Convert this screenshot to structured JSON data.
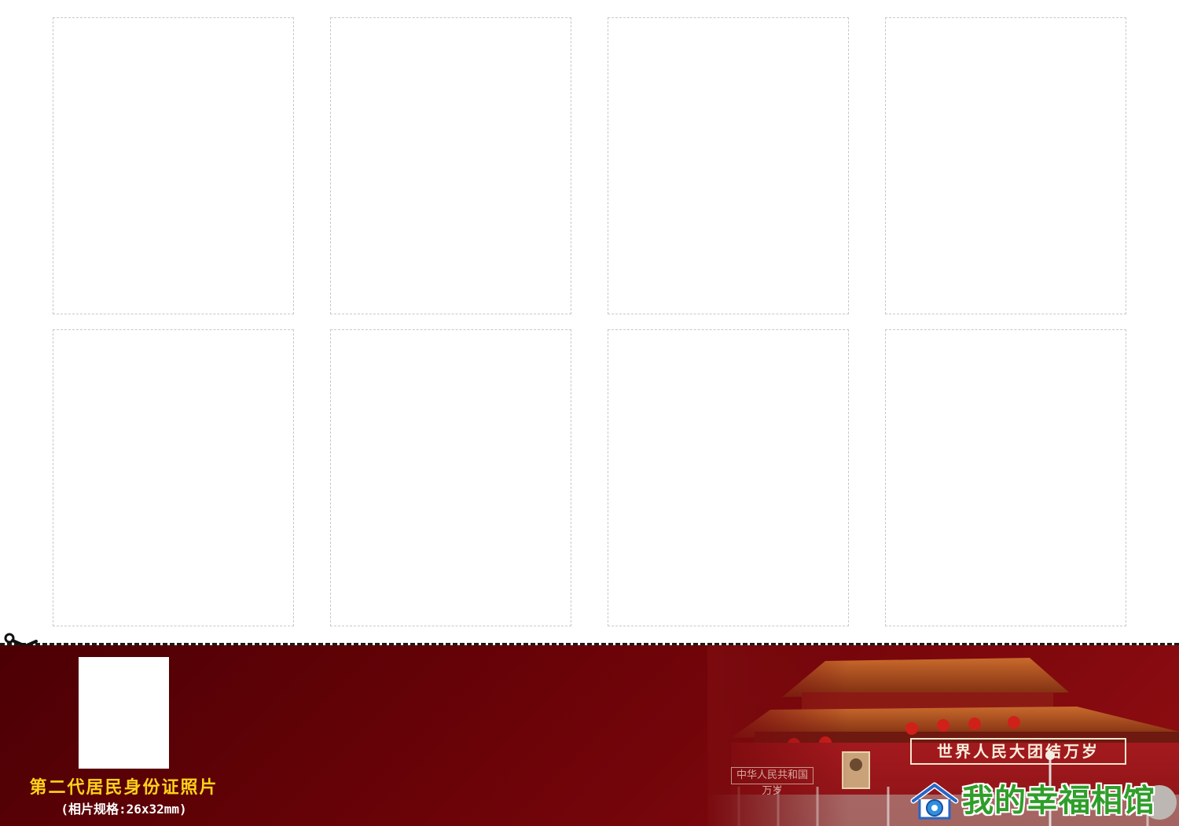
{
  "sheet": {
    "slot_count": 8
  },
  "caption": {
    "title": "第二代居民身份证照片",
    "spec": "(相片规格:26x32mm)"
  },
  "gate": {
    "slogan_right": "世界人民大团结万岁",
    "slogan_left": "中华人民共和国万岁"
  },
  "brand": {
    "name": "我的幸福相馆",
    "icon": "house-camera-icon"
  },
  "colors": {
    "banner_dark": "#4c0004",
    "banner_light": "#8f0d12",
    "caption_yellow": "#ffd21a",
    "brand_green": "#2f9e2a",
    "slot_border": "#c8c8c8"
  }
}
